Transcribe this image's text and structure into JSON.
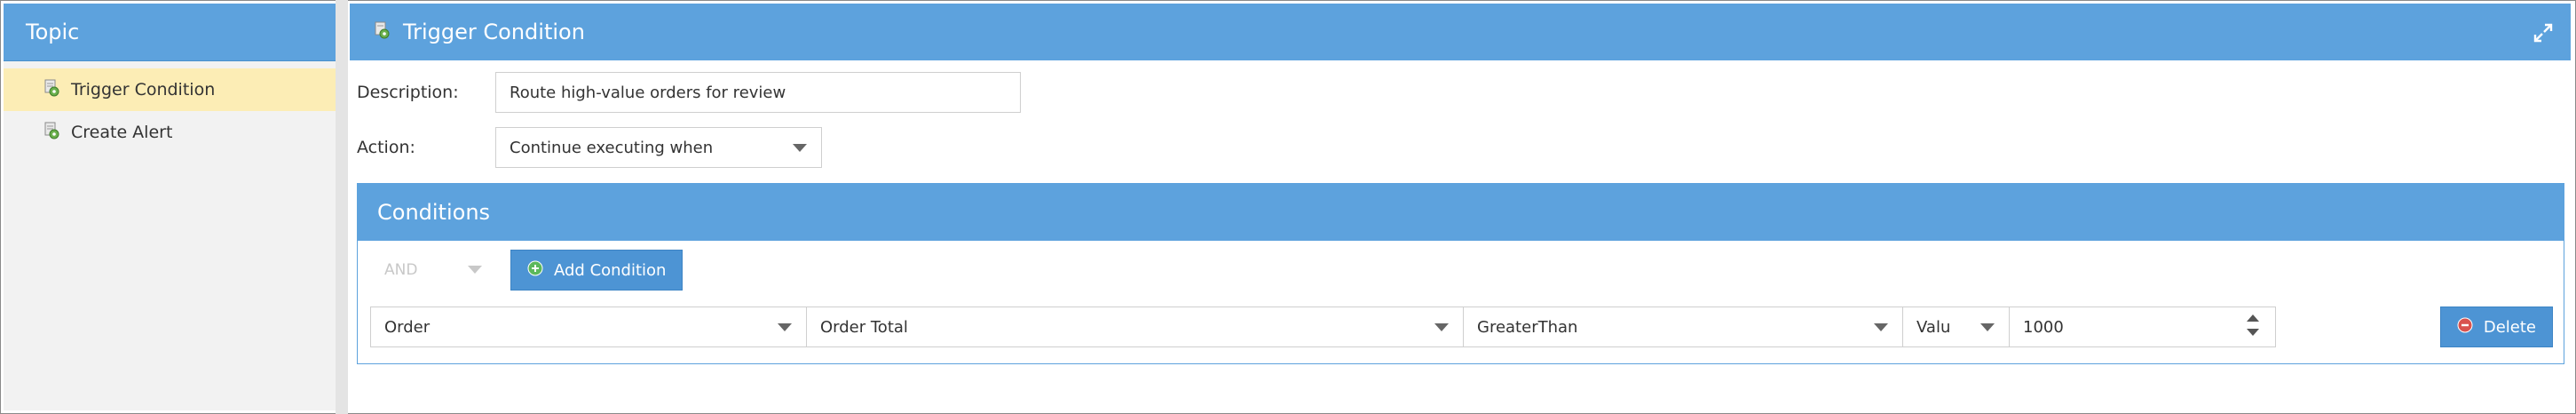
{
  "sidebar": {
    "title": "Topic",
    "items": [
      {
        "label": "Trigger Condition",
        "active": true
      },
      {
        "label": "Create Alert",
        "active": false
      }
    ]
  },
  "main": {
    "title": "Trigger Condition",
    "description_label": "Description:",
    "description_value": "Route high-value orders for review",
    "action_label": "Action:",
    "action_value": "Continue executing when"
  },
  "conditions": {
    "title": "Conditions",
    "operator": "AND",
    "add_label": "Add Condition",
    "row": {
      "entity": "Order",
      "field": "Order Total",
      "comparison": "GreaterThan",
      "value_type": "Valu",
      "value": "1000",
      "delete_label": "Delete"
    }
  },
  "colors": {
    "header_blue": "#5da2dd",
    "active_item": "#fcedb5",
    "button_blue": "#4d94d4",
    "delete_icon_red": "#d9534f",
    "add_icon_green": "#5cb85c"
  },
  "icons": [
    "document-gear-icon",
    "expand-icon",
    "plus-circle-icon",
    "minus-circle-icon"
  ]
}
